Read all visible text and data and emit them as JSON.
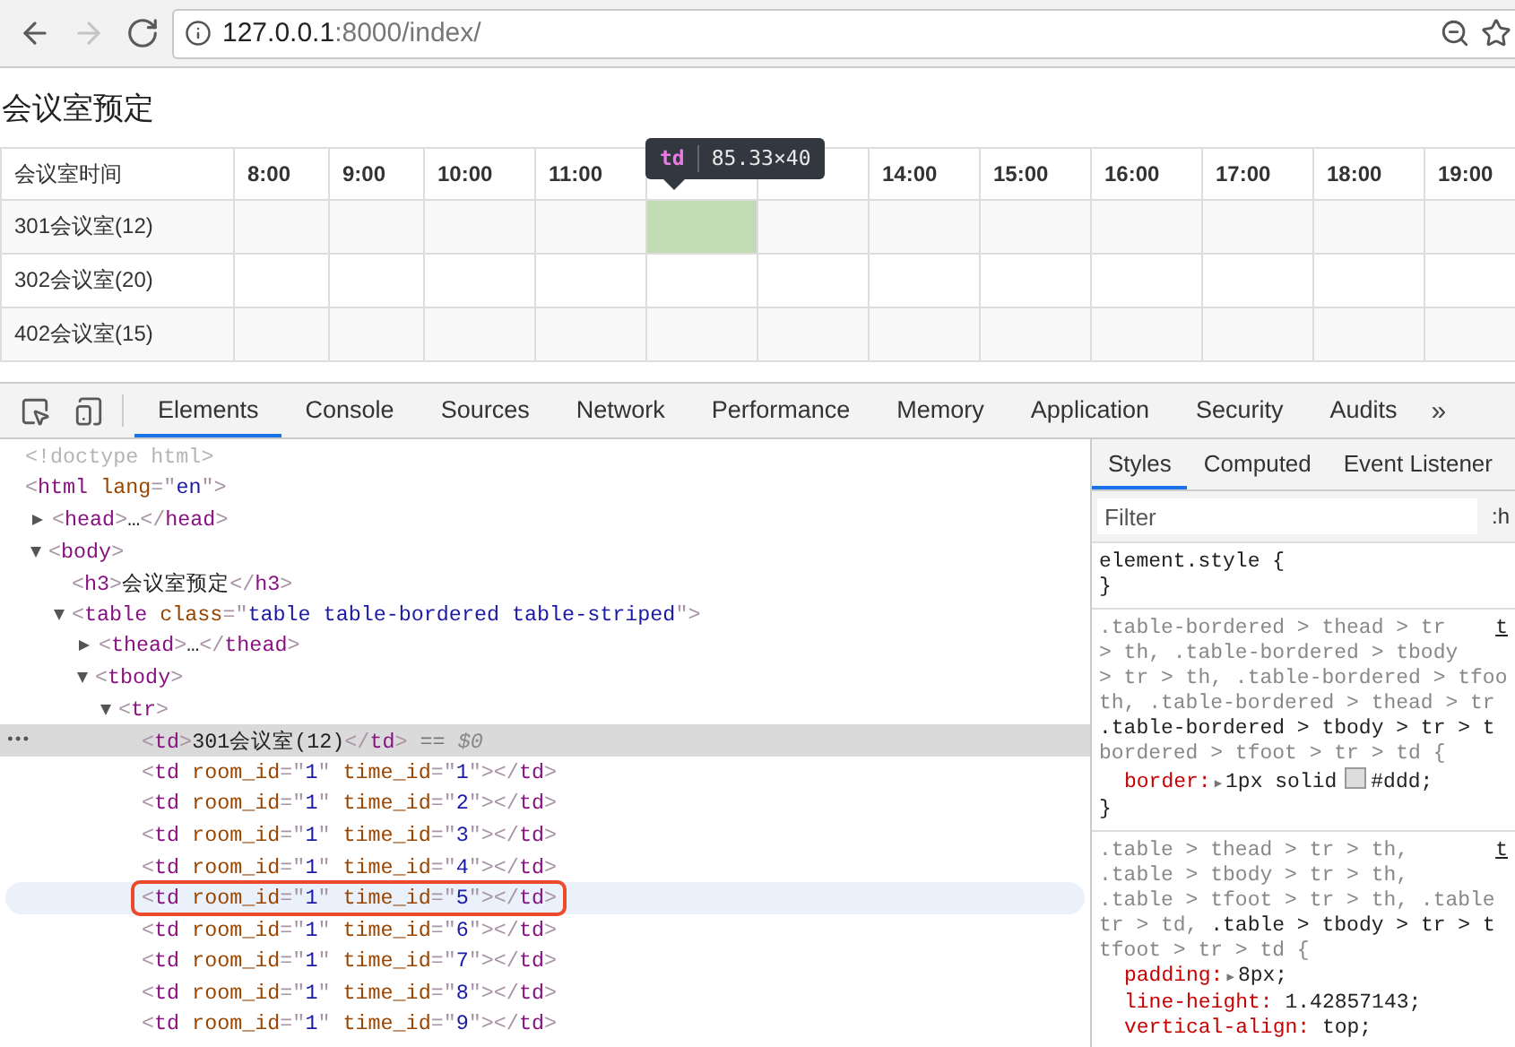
{
  "browser": {
    "nav": [
      {
        "kind": "back",
        "disabled": false
      },
      {
        "kind": "forward",
        "disabled": true
      },
      {
        "kind": "reload",
        "disabled": false
      }
    ],
    "url": {
      "host": "127.0.0.1",
      "path": ":8000/index/"
    }
  },
  "page": {
    "heading": "会议室预定",
    "table": {
      "columns": [
        {
          "label": "会议室时间"
        },
        {
          "label": "8:00"
        },
        {
          "label": "9:00"
        },
        {
          "label": "10:00"
        },
        {
          "label": "11:00"
        },
        {},
        {},
        {
          "label": "14:00"
        },
        {
          "label": "15:00"
        },
        {
          "label": "16:00"
        },
        {
          "label": "17:00"
        },
        {
          "label": "18:00"
        },
        {
          "label": "19:00"
        }
      ],
      "rows": [
        {
          "room": "301会议室(12)",
          "booked": [
            false,
            false,
            false,
            false,
            true,
            false,
            false,
            false,
            false,
            false,
            false,
            false
          ]
        },
        {
          "room": "302会议室(20)",
          "booked": [
            false,
            false,
            false,
            false,
            false,
            false,
            false,
            false,
            false,
            false,
            false,
            false
          ]
        },
        {
          "room": "402会议室(15)",
          "booked": [
            false,
            false,
            false,
            false,
            false,
            false,
            false,
            false,
            false,
            false,
            false,
            false
          ]
        }
      ]
    },
    "tooltip": {
      "tag": "td",
      "size": "85.33×40"
    }
  },
  "devtools": {
    "tabs": [
      {
        "label": "Elements",
        "selected": true
      },
      {
        "label": "Console",
        "selected": false
      },
      {
        "label": "Sources",
        "selected": false
      },
      {
        "label": "Network",
        "selected": false
      },
      {
        "label": "Performance",
        "selected": false
      },
      {
        "label": "Memory",
        "selected": false
      },
      {
        "label": "Application",
        "selected": false
      },
      {
        "label": "Security",
        "selected": false
      },
      {
        "label": "Audits",
        "selected": false
      }
    ],
    "more": "»",
    "tree": [
      {
        "tokens": [
          {
            "d": "<!doctype html>"
          }
        ]
      },
      {
        "tokens": [
          {
            "p": "<"
          },
          {
            "t": "html"
          },
          {
            "a": " lang"
          },
          {
            "p": "=\""
          },
          {
            "v": "en"
          },
          {
            "p": "\">"
          }
        ],
        "children": [
          {
            "expanded": false,
            "tokens": [
              {
                "p": "<"
              },
              {
                "t": "head"
              },
              {
                "p": ">"
              },
              {
                "x": "…"
              },
              {
                "p": "</"
              },
              {
                "t": "head"
              },
              {
                "p": ">"
              }
            ]
          },
          {
            "expanded": true,
            "tokens": [
              {
                "p": "<"
              },
              {
                "t": "body"
              },
              {
                "p": ">"
              }
            ],
            "children": [
              {
                "tokens": [
                  {
                    "p": "<"
                  },
                  {
                    "t": "h3"
                  },
                  {
                    "p": ">"
                  },
                  {
                    "x": "会议室预定"
                  },
                  {
                    "p": "</"
                  },
                  {
                    "t": "h3"
                  },
                  {
                    "p": ">"
                  }
                ]
              },
              {
                "expanded": true,
                "tokens": [
                  {
                    "p": "<"
                  },
                  {
                    "t": "table"
                  },
                  {
                    "a": " class"
                  },
                  {
                    "p": "=\""
                  },
                  {
                    "v": "table table-bordered table-striped"
                  },
                  {
                    "p": "\">"
                  }
                ],
                "children": [
                  {
                    "expanded": false,
                    "tokens": [
                      {
                        "p": "<"
                      },
                      {
                        "t": "thead"
                      },
                      {
                        "p": ">"
                      },
                      {
                        "x": "…"
                      },
                      {
                        "p": "</"
                      },
                      {
                        "t": "thead"
                      },
                      {
                        "p": ">"
                      }
                    ]
                  },
                  {
                    "expanded": true,
                    "tokens": [
                      {
                        "p": "<"
                      },
                      {
                        "t": "tbody"
                      },
                      {
                        "p": ">"
                      }
                    ],
                    "children": [
                      {
                        "expanded": true,
                        "tokens": [
                          {
                            "p": "<"
                          },
                          {
                            "t": "tr"
                          },
                          {
                            "p": ">"
                          }
                        ],
                        "children": [
                          {
                            "selected": true,
                            "hovered": false,
                            "annotated": false,
                            "gutter": "•••",
                            "tokens": [
                              {
                                "p": "<"
                              },
                              {
                                "t": "td"
                              },
                              {
                                "p": ">"
                              },
                              {
                                "x": "301会议室(12)"
                              },
                              {
                                "p": "</"
                              },
                              {
                                "t": "td"
                              },
                              {
                                "p": ">"
                              },
                              {
                                "eq": " == "
                              },
                              {
                                "var": "$0"
                              }
                            ]
                          },
                          {
                            "selected": false,
                            "hovered": false,
                            "annotated": false,
                            "tokens": [
                              {
                                "p": "<"
                              },
                              {
                                "t": "td"
                              },
                              {
                                "a": " room_id"
                              },
                              {
                                "p": "=\""
                              },
                              {
                                "v": "1"
                              },
                              {
                                "p": "\""
                              },
                              {
                                "a": " time_id"
                              },
                              {
                                "p": "=\""
                              },
                              {
                                "v": "1"
                              },
                              {
                                "p": "\"></"
                              },
                              {
                                "t": "td"
                              },
                              {
                                "p": ">"
                              }
                            ]
                          },
                          {
                            "selected": false,
                            "hovered": false,
                            "annotated": false,
                            "tokens": [
                              {
                                "p": "<"
                              },
                              {
                                "t": "td"
                              },
                              {
                                "a": " room_id"
                              },
                              {
                                "p": "=\""
                              },
                              {
                                "v": "1"
                              },
                              {
                                "p": "\""
                              },
                              {
                                "a": " time_id"
                              },
                              {
                                "p": "=\""
                              },
                              {
                                "v": "2"
                              },
                              {
                                "p": "\"></"
                              },
                              {
                                "t": "td"
                              },
                              {
                                "p": ">"
                              }
                            ]
                          },
                          {
                            "selected": false,
                            "hovered": false,
                            "annotated": false,
                            "tokens": [
                              {
                                "p": "<"
                              },
                              {
                                "t": "td"
                              },
                              {
                                "a": " room_id"
                              },
                              {
                                "p": "=\""
                              },
                              {
                                "v": "1"
                              },
                              {
                                "p": "\""
                              },
                              {
                                "a": " time_id"
                              },
                              {
                                "p": "=\""
                              },
                              {
                                "v": "3"
                              },
                              {
                                "p": "\"></"
                              },
                              {
                                "t": "td"
                              },
                              {
                                "p": ">"
                              }
                            ]
                          },
                          {
                            "selected": false,
                            "hovered": false,
                            "annotated": false,
                            "tokens": [
                              {
                                "p": "<"
                              },
                              {
                                "t": "td"
                              },
                              {
                                "a": " room_id"
                              },
                              {
                                "p": "=\""
                              },
                              {
                                "v": "1"
                              },
                              {
                                "p": "\""
                              },
                              {
                                "a": " time_id"
                              },
                              {
                                "p": "=\""
                              },
                              {
                                "v": "4"
                              },
                              {
                                "p": "\"></"
                              },
                              {
                                "t": "td"
                              },
                              {
                                "p": ">"
                              }
                            ]
                          },
                          {
                            "selected": false,
                            "hovered": true,
                            "annotated": true,
                            "tokens": [
                              {
                                "p": "<"
                              },
                              {
                                "t": "td"
                              },
                              {
                                "a": " room_id"
                              },
                              {
                                "p": "=\""
                              },
                              {
                                "v": "1"
                              },
                              {
                                "p": "\""
                              },
                              {
                                "a": " time_id"
                              },
                              {
                                "p": "=\""
                              },
                              {
                                "v": "5"
                              },
                              {
                                "p": "\"></"
                              },
                              {
                                "t": "td"
                              },
                              {
                                "p": ">"
                              }
                            ]
                          },
                          {
                            "selected": false,
                            "hovered": false,
                            "annotated": false,
                            "tokens": [
                              {
                                "p": "<"
                              },
                              {
                                "t": "td"
                              },
                              {
                                "a": " room_id"
                              },
                              {
                                "p": "=\""
                              },
                              {
                                "v": "1"
                              },
                              {
                                "p": "\""
                              },
                              {
                                "a": " time_id"
                              },
                              {
                                "p": "=\""
                              },
                              {
                                "v": "6"
                              },
                              {
                                "p": "\"></"
                              },
                              {
                                "t": "td"
                              },
                              {
                                "p": ">"
                              }
                            ]
                          },
                          {
                            "selected": false,
                            "hovered": false,
                            "annotated": false,
                            "tokens": [
                              {
                                "p": "<"
                              },
                              {
                                "t": "td"
                              },
                              {
                                "a": " room_id"
                              },
                              {
                                "p": "=\""
                              },
                              {
                                "v": "1"
                              },
                              {
                                "p": "\""
                              },
                              {
                                "a": " time_id"
                              },
                              {
                                "p": "=\""
                              },
                              {
                                "v": "7"
                              },
                              {
                                "p": "\"></"
                              },
                              {
                                "t": "td"
                              },
                              {
                                "p": ">"
                              }
                            ]
                          },
                          {
                            "selected": false,
                            "hovered": false,
                            "annotated": false,
                            "tokens": [
                              {
                                "p": "<"
                              },
                              {
                                "t": "td"
                              },
                              {
                                "a": " room_id"
                              },
                              {
                                "p": "=\""
                              },
                              {
                                "v": "1"
                              },
                              {
                                "p": "\""
                              },
                              {
                                "a": " time_id"
                              },
                              {
                                "p": "=\""
                              },
                              {
                                "v": "8"
                              },
                              {
                                "p": "\"></"
                              },
                              {
                                "t": "td"
                              },
                              {
                                "p": ">"
                              }
                            ]
                          },
                          {
                            "selected": false,
                            "hovered": false,
                            "annotated": false,
                            "tokens": [
                              {
                                "p": "<"
                              },
                              {
                                "t": "td"
                              },
                              {
                                "a": " room_id"
                              },
                              {
                                "p": "=\""
                              },
                              {
                                "v": "1"
                              },
                              {
                                "p": "\""
                              },
                              {
                                "a": " time_id"
                              },
                              {
                                "p": "=\""
                              },
                              {
                                "v": "9"
                              },
                              {
                                "p": "\"></"
                              },
                              {
                                "t": "td"
                              },
                              {
                                "p": ">"
                              }
                            ]
                          }
                        ]
                      }
                    ]
                  }
                ]
              }
            ]
          }
        ]
      }
    ],
    "styles": {
      "tabs": [
        {
          "label": "Styles",
          "selected": true
        },
        {
          "label": "Computed",
          "selected": false
        },
        {
          "label": "Event Listener",
          "selected": false
        }
      ],
      "filter": {
        "placeholder": "Filter"
      },
      "filter_option": ":h",
      "rules": [
        {
          "selector": [
            {
              "text": "element.style {",
              "matched": true
            }
          ],
          "close": "}"
        },
        {
          "source": "t",
          "selector": [
            {
              "text": ".table-bordered > thead > tr",
              "matched": false
            },
            {
              "text": "> th, .table-bordered > tbody",
              "matched": false
            },
            {
              "text": "> tr > th, .table-bordered > tfoo",
              "matched": false
            },
            {
              "text": "th, .table-bordered > thead > tr",
              "matched": false
            },
            {
              "text": ".table-bordered > tbody > tr > t",
              "matched": true
            },
            {
              "text": "bordered > tfoot > tr > td {",
              "matched": false
            }
          ],
          "properties": [
            {
              "name": "border:",
              "toggle": "▶",
              "value": "1px solid",
              "color": "#dddddd",
              "value_after": "#ddd;"
            }
          ],
          "close": "}"
        },
        {
          "source": "t",
          "selector": [
            {
              "text": ".table > thead > tr > th,",
              "matched": false
            },
            {
              "text": ".table > tbody > tr > th,",
              "matched": false
            },
            {
              "text": ".table > tfoot > tr > th, .table",
              "matched": false
            },
            {
              "text": "tr > td, **.table > tbody > tr > t**",
              "matched": false
            },
            {
              "text": "tfoot > tr > td {",
              "matched": false
            }
          ],
          "properties": [
            {
              "name": "padding:",
              "toggle": "▶",
              "value": "8px;"
            },
            {
              "name": "line-height:",
              "value": "1.42857143;"
            },
            {
              "name": "vertical-align:",
              "value": "top;"
            }
          ]
        }
      ]
    }
  }
}
